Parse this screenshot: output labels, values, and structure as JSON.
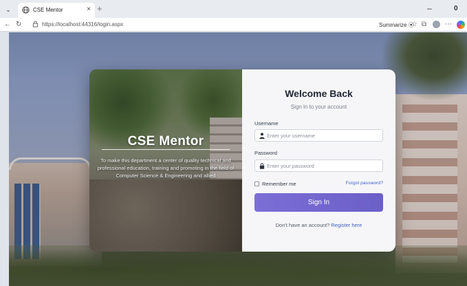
{
  "browser": {
    "tab_title": "CSE Mentor",
    "tab_close": "×",
    "new_tab": "+",
    "url": "https://localhost:44316/login.aspx",
    "summarize_label": "Summarize",
    "window_minimize": "–",
    "window_maximize": "0"
  },
  "brand": {
    "title": "CSE Mentor",
    "description": "To make this department a center of quality technical and professional education, training and promoting in the field of Computer Science & Engineering and allied"
  },
  "login": {
    "title": "Welcome Back",
    "subtitle": "Sign in to your account",
    "username_label": "Username",
    "username_placeholder": "Enter your username",
    "password_label": "Password",
    "password_placeholder": "Enter your password",
    "remember_label": "Remember me",
    "forgot_label": "Forgot password?",
    "signin_label": "Sign In",
    "register_prompt": "Don't have an account?",
    "register_link": "Register here"
  },
  "colors": {
    "accent": "#6b5fc8",
    "link": "#3d5fc4"
  },
  "icons": [
    "tab-actions-icon",
    "globe-icon",
    "back-icon",
    "refresh-icon",
    "lock-icon",
    "summarize-icon",
    "favorite-icon",
    "collections-icon",
    "profile-icon",
    "more-icon",
    "copilot-icon",
    "user-icon",
    "padlock-icon"
  ]
}
